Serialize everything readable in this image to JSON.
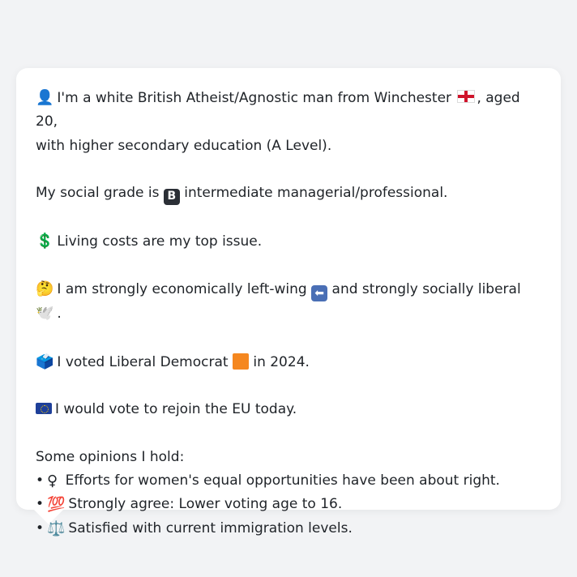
{
  "profile": {
    "line1": "I'm a white British Atheist/Agnostic man from Winchester",
    "line1b": ", aged 20,",
    "line2": "with higher secondary education (A Level).",
    "social_grade_prefix": "My social grade is",
    "social_grade_letter": "B",
    "social_grade_suffix": "intermediate managerial/professional.",
    "top_issue": "Living costs are my top issue.",
    "ideology_prefix": "I am strongly economically left-wing",
    "ideology_middle": "and strongly socially liberal",
    "ideology_end": ".",
    "vote_prefix": "I voted Liberal Democrat",
    "vote_suffix": "in 2024.",
    "eu": "I would vote to rejoin the EU today.",
    "opinions_heading": "Some opinions I hold:",
    "opinions": [
      "Efforts for women's equal opportunities have been about right.",
      "Strongly agree: Lower voting age to 16.",
      "Satisfied with current immigration levels."
    ],
    "emoji": {
      "person": "👤",
      "dollar": "💲",
      "thinking": "🤔",
      "ballot": "🗳️",
      "dove": "🕊️",
      "female": "♀",
      "hundred": "💯",
      "scales": "⚖️"
    }
  }
}
